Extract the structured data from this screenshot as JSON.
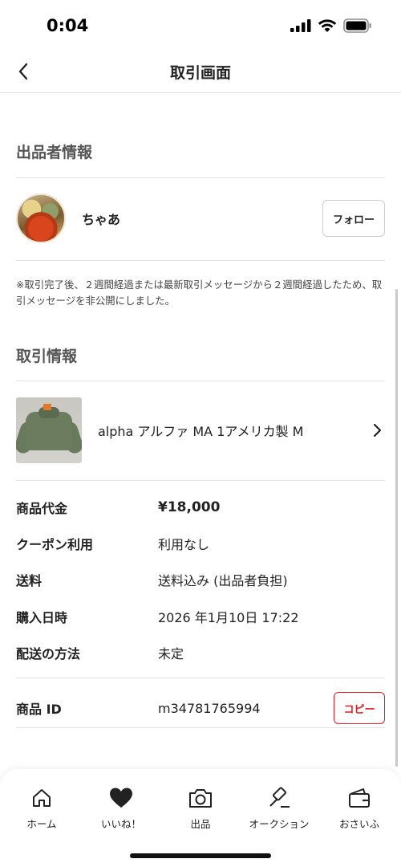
{
  "status_bar": {
    "time": "0:04"
  },
  "nav": {
    "title": "取引画面"
  },
  "seller_section": {
    "header": "出品者情報",
    "seller_name": "ちゃあ",
    "follow_label": "フォロー",
    "notice": "※取引完了後、２週間経過または最新取引メッセージから２週間経過したため、取引メッセージを非公開にしました。"
  },
  "transaction_section": {
    "header": "取引情報",
    "item_title": "alpha アルファ MA 1アメリカ製 M",
    "details": [
      {
        "label": "商品代金",
        "value": "¥18,000"
      },
      {
        "label": "クーポン利用",
        "value": "利用なし"
      },
      {
        "label": "送料",
        "value": "送料込み (出品者負担)"
      },
      {
        "label": "購入日時",
        "value": "2026 年1月10日 17:22"
      },
      {
        "label": "配送の方法",
        "value": "未定"
      }
    ],
    "item_id_label": "商品 ID",
    "item_id_value": "m34781765994",
    "copy_label": "コピー"
  },
  "tab_bar": {
    "items": [
      {
        "label": "ホーム",
        "icon": "home-icon"
      },
      {
        "label": "いいね！",
        "icon": "heart-icon"
      },
      {
        "label": "出品",
        "icon": "camera-icon"
      },
      {
        "label": "オークション",
        "icon": "gavel-icon"
      },
      {
        "label": "おさいふ",
        "icon": "wallet-icon"
      }
    ]
  }
}
